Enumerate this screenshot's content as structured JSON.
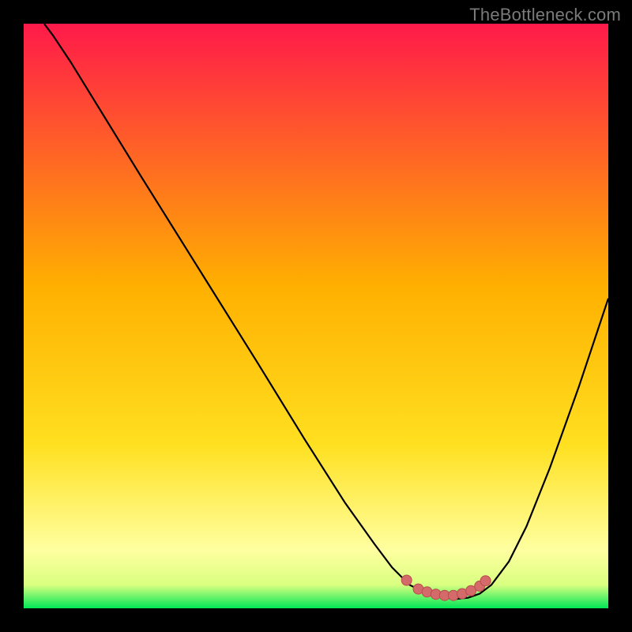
{
  "watermark": "TheBottleneck.com",
  "colors": {
    "gradient_top": "#ff1a4a",
    "gradient_mid": "#ffd21f",
    "gradient_yellowwhite": "#ffffa0",
    "gradient_bottom": "#00e756",
    "curve": "#000000",
    "points_fill": "#d46a6a",
    "points_stroke": "#b94c4c"
  },
  "chart_data": {
    "type": "line",
    "title": "",
    "xlabel": "",
    "ylabel": "",
    "xlim": [
      0,
      100
    ],
    "ylim": [
      0,
      100
    ],
    "curve": [
      {
        "x": 3.5,
        "y": 100
      },
      {
        "x": 5,
        "y": 98
      },
      {
        "x": 8,
        "y": 93.5
      },
      {
        "x": 12,
        "y": 87
      },
      {
        "x": 20,
        "y": 74
      },
      {
        "x": 30,
        "y": 58
      },
      {
        "x": 40,
        "y": 42
      },
      {
        "x": 48,
        "y": 29
      },
      {
        "x": 55,
        "y": 18
      },
      {
        "x": 60,
        "y": 11
      },
      {
        "x": 63,
        "y": 7
      },
      {
        "x": 66,
        "y": 4
      },
      {
        "x": 69,
        "y": 2.5
      },
      {
        "x": 72,
        "y": 1.8
      },
      {
        "x": 74,
        "y": 1.6
      },
      {
        "x": 76,
        "y": 1.8
      },
      {
        "x": 78,
        "y": 2.5
      },
      {
        "x": 80,
        "y": 4
      },
      {
        "x": 83,
        "y": 8
      },
      {
        "x": 86,
        "y": 14
      },
      {
        "x": 90,
        "y": 24
      },
      {
        "x": 95,
        "y": 38
      },
      {
        "x": 100,
        "y": 53
      }
    ],
    "scatter": [
      {
        "x": 65.5,
        "y": 4.8
      },
      {
        "x": 67.5,
        "y": 3.3
      },
      {
        "x": 69.0,
        "y": 2.8
      },
      {
        "x": 70.5,
        "y": 2.4
      },
      {
        "x": 72.0,
        "y": 2.2
      },
      {
        "x": 73.5,
        "y": 2.2
      },
      {
        "x": 75.0,
        "y": 2.5
      },
      {
        "x": 76.5,
        "y": 3.0
      },
      {
        "x": 78.0,
        "y": 3.8
      },
      {
        "x": 79.0,
        "y": 4.7
      }
    ]
  }
}
